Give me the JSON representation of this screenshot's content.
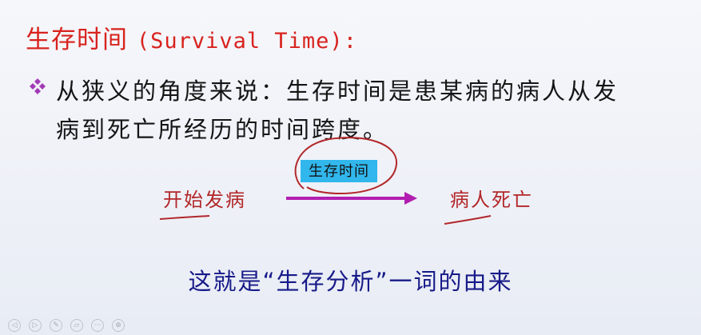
{
  "slide": {
    "title_cjk": "生存时间",
    "title_latin": "(Survival Time):",
    "bullet_line1": "从狭义的角度来说：生存时间是患某病的病人从发",
    "bullet_line2": "病到死亡所经历的时间跨度。",
    "diagram": {
      "start_label": "开始发病",
      "end_label": "病人死亡",
      "arrow_label": "生存时间"
    },
    "conclusion": "这就是“生存分析”一词的由来"
  },
  "toolbar": {
    "items": [
      {
        "icon": "previous-icon",
        "glyph": "◁"
      },
      {
        "icon": "next-icon",
        "glyph": "▷"
      },
      {
        "icon": "pen-icon",
        "glyph": "✎"
      },
      {
        "icon": "eraser-icon",
        "glyph": "▱"
      },
      {
        "icon": "menu-icon",
        "glyph": "⋯"
      },
      {
        "icon": "zoom-icon",
        "glyph": "⊕"
      }
    ]
  },
  "colors": {
    "title": "#d8231e",
    "body_text": "#151515",
    "hand_annotation": "#b2272a",
    "arrow": "#b21fb0",
    "time_box": "#31b7ec",
    "conclusion": "#171a88"
  }
}
